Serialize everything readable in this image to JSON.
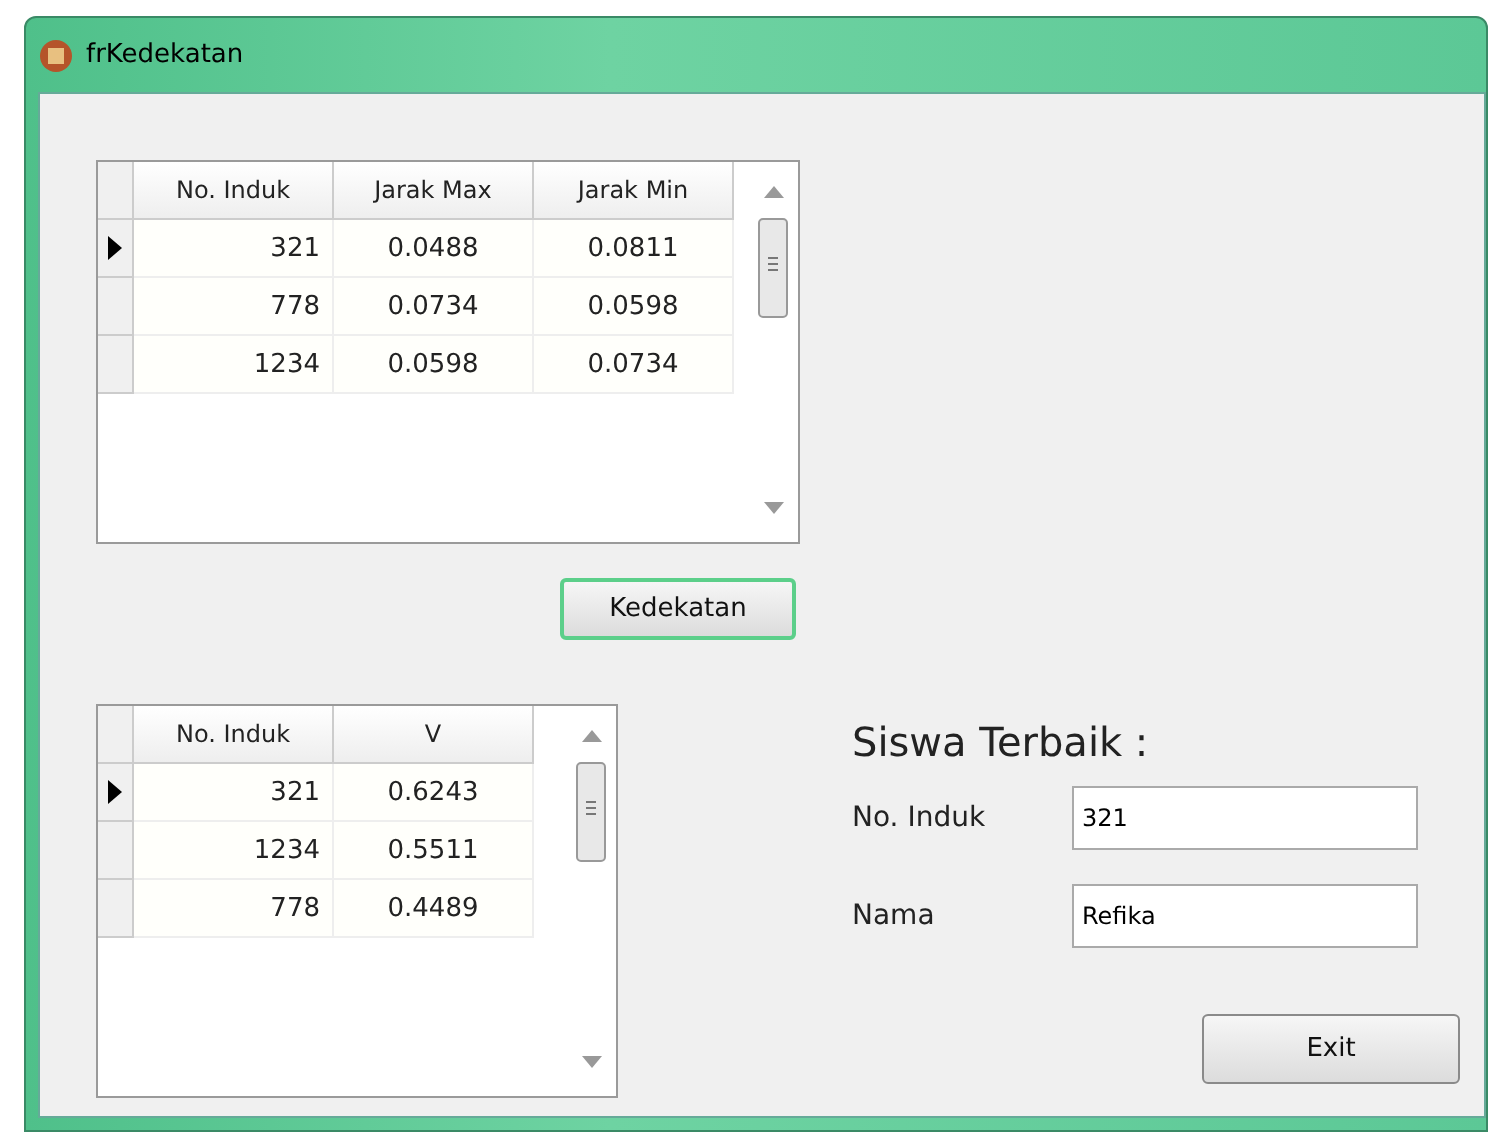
{
  "window": {
    "title": "frKedekatan"
  },
  "distance_table": {
    "columns": [
      "No. Induk",
      "Jarak Max",
      "Jarak Min"
    ],
    "rows": [
      {
        "selected": true,
        "cells": [
          "321",
          "0.0488",
          "0.0811"
        ]
      },
      {
        "selected": false,
        "cells": [
          "778",
          "0.0734",
          "0.0598"
        ]
      },
      {
        "selected": false,
        "cells": [
          "1234",
          "0.0598",
          "0.0734"
        ]
      }
    ]
  },
  "kedekatan_button": {
    "label": "Kedekatan",
    "focused": true
  },
  "result_table": {
    "columns": [
      "No. Induk",
      "V"
    ],
    "rows": [
      {
        "selected": true,
        "cells": [
          "321",
          "0.6243"
        ]
      },
      {
        "selected": false,
        "cells": [
          "1234",
          "0.5511"
        ]
      },
      {
        "selected": false,
        "cells": [
          "778",
          "0.4489"
        ]
      }
    ]
  },
  "best_student": {
    "heading": "Siswa Terbaik :",
    "fields": [
      {
        "label": "No. Induk",
        "value": "321"
      },
      {
        "label": "Nama",
        "value": "Refika"
      }
    ]
  },
  "exit_button": {
    "label": "Exit",
    "focused": false
  }
}
